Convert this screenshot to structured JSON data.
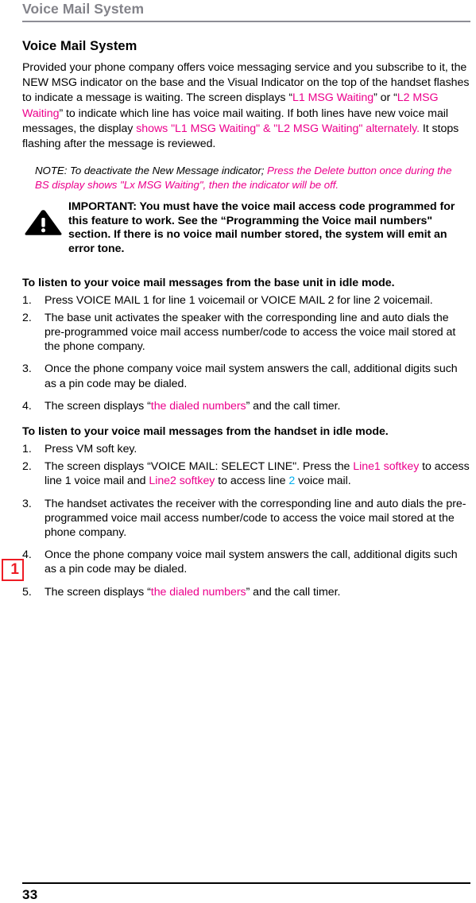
{
  "header": {
    "running_title": "Voice Mail System"
  },
  "section": {
    "title": "Voice Mail System",
    "intro": {
      "part1": "Provided your phone company offers voice messaging service and you subscribe to it, the NEW MSG indicator on the base and the Visual Indicator on the top of the handset flashes to indicate a message is waiting. The screen displays “",
      "highlight1": "L1 MSG Waiting",
      "part2": "” or “",
      "highlight2": "L2 MSG Waiting",
      "part3": "” to indicate which line has voice mail waiting. If both lines have new voice mail messages, the display ",
      "highlight3": "shows \"L1 MSG Waiting\" & \"L2 MSG Waiting\" alternately.",
      "part4": " It stops flashing after the message is reviewed."
    }
  },
  "note": {
    "label_text": "NOTE: To deactivate the New Message indicator; ",
    "highlight": "Press the Delete button once during the BS display shows \"Lx MSG Waiting\", then the indicator will be off."
  },
  "important": {
    "icon": "warning-triangle-icon",
    "text": "IMPORTANT: You must have the voice mail access code programmed for this feature to work. See the “Programming the Voice mail numbers\" section. If there is no voice mail number stored, the system will emit an error tone."
  },
  "base_procedure": {
    "heading": "To listen to your voice mail messages from the base unit in idle mode.",
    "steps": [
      {
        "num": "1.",
        "text": "Press VOICE MAIL 1 for line 1 voicemail or VOICE MAIL 2 for line 2 voicemail."
      },
      {
        "num": "2.",
        "text": "The base unit activates the speaker with the corresponding line and auto dials the pre-programmed voice mail access number/code to access the voice mail stored at the phone company."
      },
      {
        "num": "3.",
        "text": "Once the phone company voice mail system answers the call, additional digits such as a pin code may be dialed."
      },
      {
        "num": "4.",
        "text_part1": "The screen displays “",
        "highlight": "the dialed numbers",
        "text_part2": "” and the call timer."
      }
    ]
  },
  "handset_procedure": {
    "heading": "To listen to your voice mail messages from the handset in idle mode.",
    "steps": [
      {
        "num": "1.",
        "text": "Press VM soft key."
      },
      {
        "num": "2.",
        "text_part1": "The screen displays “VOICE MAIL: SELECT LINE\". Press the ",
        "highlight1": "Line1 softkey",
        "text_part2": " to access line 1 voice mail and ",
        "highlight2": "Line2 softkey",
        "text_part3": " to access line ",
        "highlight3": "2",
        "text_part4": " voice mail."
      },
      {
        "num": "3.",
        "text": "The handset activates the receiver with the corresponding line and auto dials the pre-programmed voice mail access number/code to access the voice mail stored at the phone company."
      },
      {
        "num": "4.",
        "text": "Once the phone company voice mail system answers the call, additional digits such as a pin code may be dialed."
      },
      {
        "num": "5.",
        "text_part1": "The screen displays “",
        "highlight": "the dialed numbers",
        "text_part2": "” and the call timer."
      }
    ]
  },
  "annotation": {
    "badge_label": "1"
  },
  "footer": {
    "page_number": "33"
  },
  "colors": {
    "highlight_magenta": "#ec008c",
    "highlight_cyan": "#00aeef",
    "annotation_red": "#ee1c25",
    "header_gray": "#83838a"
  }
}
